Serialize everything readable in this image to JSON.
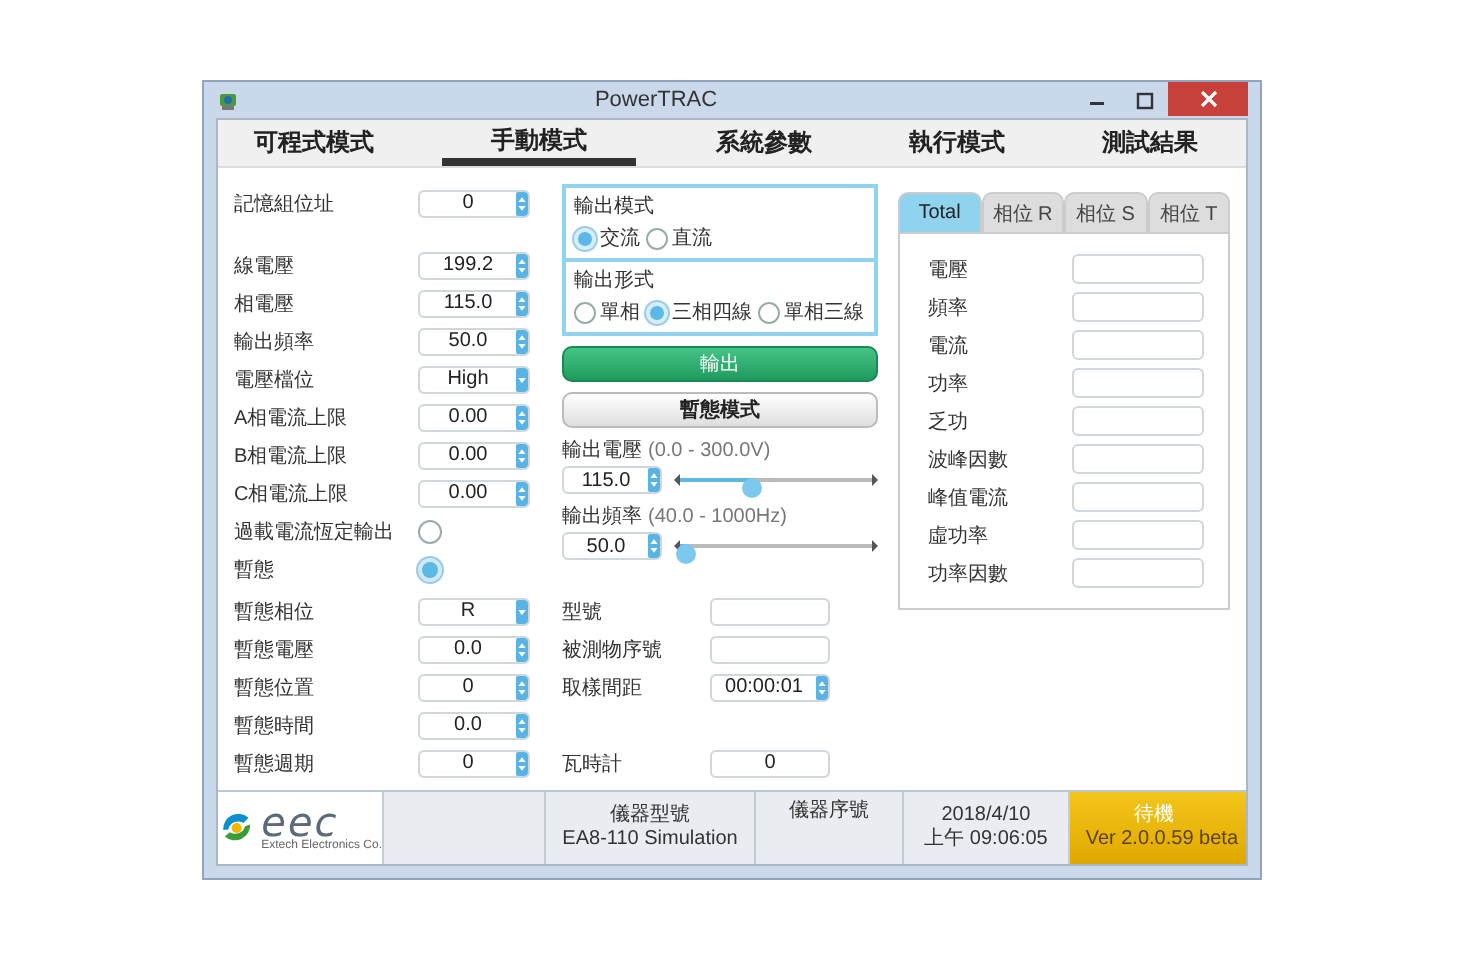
{
  "window": {
    "title": "PowerTRAC"
  },
  "tabs": [
    {
      "label": "可程式模式",
      "selected": false
    },
    {
      "label": "手動模式",
      "selected": true
    },
    {
      "label": "系統參數",
      "selected": false
    },
    {
      "label": "執行模式",
      "selected": false
    },
    {
      "label": "測試結果",
      "selected": false
    }
  ],
  "settings": [
    {
      "label": "記憶組位址",
      "kind": "spin",
      "value": "0"
    },
    {
      "label": "線電壓",
      "kind": "spin",
      "value": "199.2"
    },
    {
      "label": "相電壓",
      "kind": "spin",
      "value": "115.0"
    },
    {
      "label": "輸出頻率",
      "kind": "spin",
      "value": "50.0"
    },
    {
      "label": "電壓檔位",
      "kind": "select",
      "value": "High"
    },
    {
      "label": "A相電流上限",
      "kind": "spin",
      "value": "0.00"
    },
    {
      "label": "B相電流上限",
      "kind": "spin",
      "value": "0.00"
    },
    {
      "label": "C相電流上限",
      "kind": "spin",
      "value": "0.00"
    },
    {
      "label": "過載電流恆定輸出",
      "kind": "radio",
      "checked": false
    },
    {
      "label": "暫態",
      "kind": "radio",
      "checked": true
    }
  ],
  "transient_settings": [
    {
      "label": "暫態相位",
      "kind": "select",
      "value": "R"
    },
    {
      "label": "暫態電壓",
      "kind": "spin",
      "value": "0.0"
    },
    {
      "label": "暫態位置",
      "kind": "spin",
      "value": "0"
    },
    {
      "label": "暫態時間",
      "kind": "spin",
      "value": "0.0"
    },
    {
      "label": "暫態週期",
      "kind": "spin",
      "value": "0"
    }
  ],
  "output_mode": {
    "title": "輸出模式",
    "options": [
      {
        "label": "交流",
        "selected": true
      },
      {
        "label": "直流",
        "selected": false
      }
    ]
  },
  "output_form": {
    "title": "輸出形式",
    "options": [
      {
        "label": "單相",
        "selected": false
      },
      {
        "label": "三相四線",
        "selected": true
      },
      {
        "label": "單相三線",
        "selected": false
      }
    ]
  },
  "buttons": [
    {
      "label": "輸出",
      "kind": "primary"
    },
    {
      "label": "暫態模式",
      "kind": "secondary"
    }
  ],
  "sliders": [
    {
      "label": "輸出電壓",
      "range": "(0.0 - 300.0V)",
      "value": "115.0",
      "level": 0.38
    },
    {
      "label": "輸出頻率",
      "range": "(40.0 - 1000Hz)",
      "value": "50.0",
      "level": 0.03
    }
  ],
  "info_fields": [
    {
      "label": "型號",
      "kind": "field"
    },
    {
      "label": "被測物序號",
      "kind": "field"
    },
    {
      "label": "取樣間距",
      "kind": "spin",
      "value": "00:00:01"
    },
    {
      "label": "瓦時計",
      "kind": "field",
      "value": "0"
    }
  ],
  "measurements": {
    "tabs": [
      {
        "label": "Total",
        "selected": true
      },
      {
        "label": "相位 R",
        "selected": false
      },
      {
        "label": "相位 S",
        "selected": false
      },
      {
        "label": "相位 T",
        "selected": false
      }
    ],
    "rows": [
      "電壓",
      "頻率",
      "電流",
      "功率",
      "乏功",
      "波峰因數",
      "峰值電流",
      "虛功率",
      "功率因數"
    ]
  },
  "status_bar": {
    "logo": "eec",
    "company": "Extech Electronics Co.",
    "model_label": "儀器型號",
    "model": "EA8-110 Simulation",
    "serial_label": "儀器序號",
    "date": "2018/4/10",
    "time": "上午 09:06:05",
    "state": "待機",
    "version": "Ver 2.0.0.59 beta"
  }
}
